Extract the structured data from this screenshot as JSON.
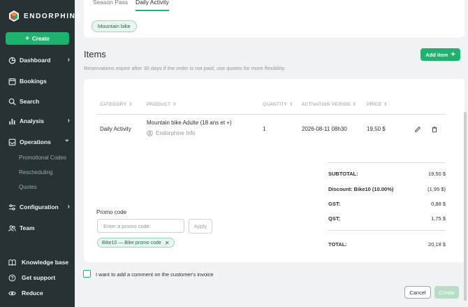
{
  "sidebar": {
    "brand": "ENDORPHINE",
    "create_label": "Create",
    "items": [
      {
        "label": "Dashboard",
        "icon": "pie-chart-icon",
        "chevron": "›"
      },
      {
        "label": "Bookings",
        "icon": "calendar-icon"
      },
      {
        "label": "Search",
        "icon": "search-icon"
      },
      {
        "label": "Analysis",
        "icon": "bar-chart-icon",
        "chevron": "›"
      },
      {
        "label": "Operations",
        "icon": "box-icon",
        "chevron": "⌄"
      },
      {
        "label": "Configuration",
        "icon": "sliders-icon",
        "chevron": "›"
      },
      {
        "label": "Team",
        "icon": "users-icon"
      }
    ],
    "subitems": [
      "Promotional Codes",
      "Rescheduling",
      "Quotes"
    ],
    "bottom": [
      {
        "label": "Knowledge base",
        "icon": "book-icon"
      },
      {
        "label": "Get support",
        "icon": "help-icon"
      },
      {
        "label": "Reduce",
        "icon": "eye-icon"
      }
    ]
  },
  "tabs": [
    "Season Pass",
    "Daily Activity"
  ],
  "active_tab": "Daily Activity",
  "filter_tag": "Mountain bike",
  "items_section": {
    "title": "Items",
    "add_label": "Add item",
    "note": "Reservations expire after 30 days if the order is not paid, use quotes for more flexibility."
  },
  "table": {
    "headers": [
      "CATEGORY",
      "PRODUCT",
      "QUANTITY",
      "ACTIVATION PERIOD",
      "PRICE"
    ],
    "row": {
      "category": "Daily Activity",
      "product": "Mountain bike Adulte (18 ans et +)",
      "owner": "Endorphine Info",
      "quantity": "1",
      "activation": "2026-08-11 08h30",
      "price": "19,50 $"
    }
  },
  "summary": [
    {
      "label": "SUBTOTAL:",
      "value": "19,50 $"
    },
    {
      "label": "Discount: Bike10 (10.00%)",
      "value": "(1,95 $)"
    },
    {
      "label": "GST:",
      "value": "0,88 $"
    },
    {
      "label": "QST:",
      "value": "1,75 $"
    },
    {
      "label": "TOTAL:",
      "value": "20,18 $"
    }
  ],
  "promo": {
    "label": "Promo code",
    "placeholder": "Enter a promo code",
    "apply_label": "Apply",
    "applied_chip": "Bike10 — Bike promo code"
  },
  "comment_label": "I want to add a comment on the customer's invoice",
  "footer": {
    "cancel_label": "Cancel",
    "create_label": "Create"
  },
  "colors": {
    "accent": "#1db36e",
    "sidebar": "#263233"
  }
}
